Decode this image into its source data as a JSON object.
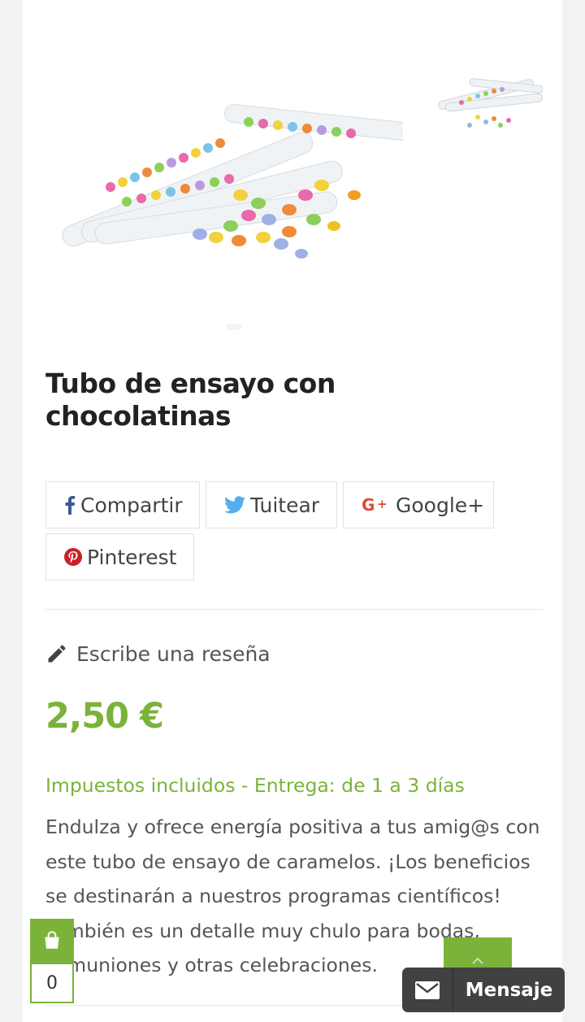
{
  "product": {
    "title": "Tubo de ensayo con chocolatinas",
    "price": "2,50 €",
    "tax_delivery": "Impuestos incluidos - Entrega: de 1 a 3 días",
    "description": "Endulza y ofrece energía positiva a tus amig@s con este tubo de ensayo de caramelos. ¡Los beneficios se destinarán a nuestros programas científicos! También es un detalle muy chulo para bodas, comuniones y otras celebraciones."
  },
  "share": {
    "facebook": "Compartir",
    "twitter": "Tuitear",
    "google": "Google+",
    "pinterest": "Pinterest"
  },
  "review": {
    "label": "Escribe una reseña"
  },
  "cart": {
    "count": "0"
  },
  "chat": {
    "label": "Mensaje"
  },
  "colors": {
    "accent": "#7bb33a",
    "facebook": "#3b5998",
    "twitter": "#55acee",
    "google": "#dd4b39",
    "pinterest": "#cb2027"
  },
  "icons": [
    "facebook-icon",
    "twitter-icon",
    "google-plus-icon",
    "pinterest-icon",
    "pencil-icon",
    "shopping-bag-icon",
    "chevron-up-icon",
    "envelope-icon"
  ]
}
